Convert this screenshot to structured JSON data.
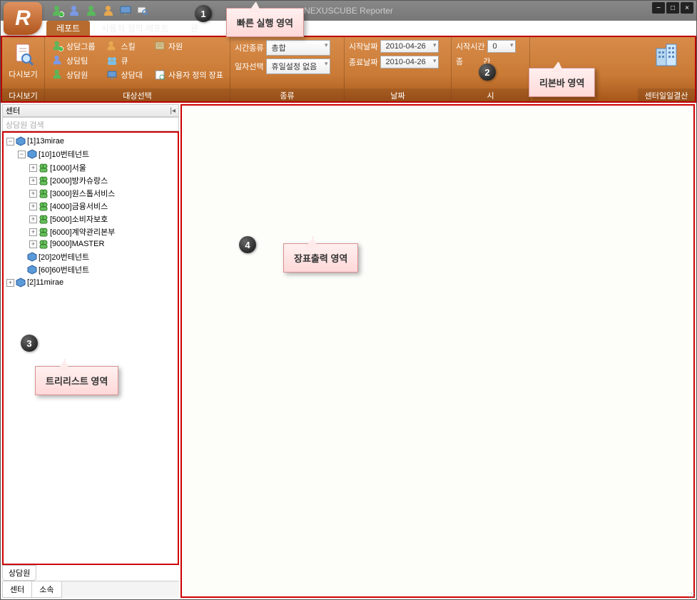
{
  "app": {
    "title": "NEXUSCUBE Reporter",
    "logo_letter": "R"
  },
  "window_buttons": {
    "min": "−",
    "max": "□",
    "close": "×"
  },
  "tabs": {
    "report": "레포트",
    "custom": "사용자 정의 레포트",
    "admin": "관"
  },
  "ribbon": {
    "preview_group": {
      "button": "다시보기",
      "label": "다시보기"
    },
    "target_group": {
      "group_btn": "상담그룹",
      "team_btn": "상담팀",
      "agent_btn": "상담원",
      "skill_btn": "스킬",
      "queue_btn": "큐",
      "desk_btn": "상담대",
      "resource_btn": "자원",
      "custom_form_btn": "사용자 정의 장표",
      "label": "대상선택"
    },
    "type_group": {
      "time_type_lbl": "시간종류",
      "time_type_val": "총합",
      "date_sel_lbl": "일자선택",
      "date_sel_val": "휴일설정 없음",
      "label": "종류"
    },
    "date_group": {
      "start_date_lbl": "시작날짜",
      "start_date_val": "2010-04-26",
      "end_date_lbl": "종료날짜",
      "end_date_val": "2010-04-26",
      "label": "날짜"
    },
    "time_group": {
      "start_time_lbl": "시작시간",
      "start_time_val": "0",
      "end_time_prefix": "종",
      "end_time_suffix": "간",
      "label": "시"
    },
    "center_group": {
      "label": "센터일일결산"
    }
  },
  "sidebar": {
    "header": "센터",
    "search_placeholder": "상담원 검색",
    "mid_tab": "상담원",
    "bottom_tabs": {
      "center": "센터",
      "dept": "소속"
    }
  },
  "tree": {
    "n0": "[1]13mirae",
    "n1": "[10]10번테넌트",
    "n2": "[1000]서울",
    "n3": "[2000]방카슈랑스",
    "n4": "[3000]원스톱서비스",
    "n5": "[4000]금융서비스",
    "n6": "[5000]소비자보호",
    "n7": "[6000]계약관리본부",
    "n8": "[9000]MASTER",
    "n9": "[20]20번테넌트",
    "n10": "[60]60번테넌트",
    "n11": "[2]11mirae"
  },
  "callouts": {
    "c1": "빠른 실행 영역",
    "c2": "리본바 영역",
    "c3": "트리리스트 영역",
    "c4": "장표출력 영역"
  },
  "badges": {
    "b1": "1",
    "b2": "2",
    "b3": "3",
    "b4": "4"
  },
  "status": ".::"
}
